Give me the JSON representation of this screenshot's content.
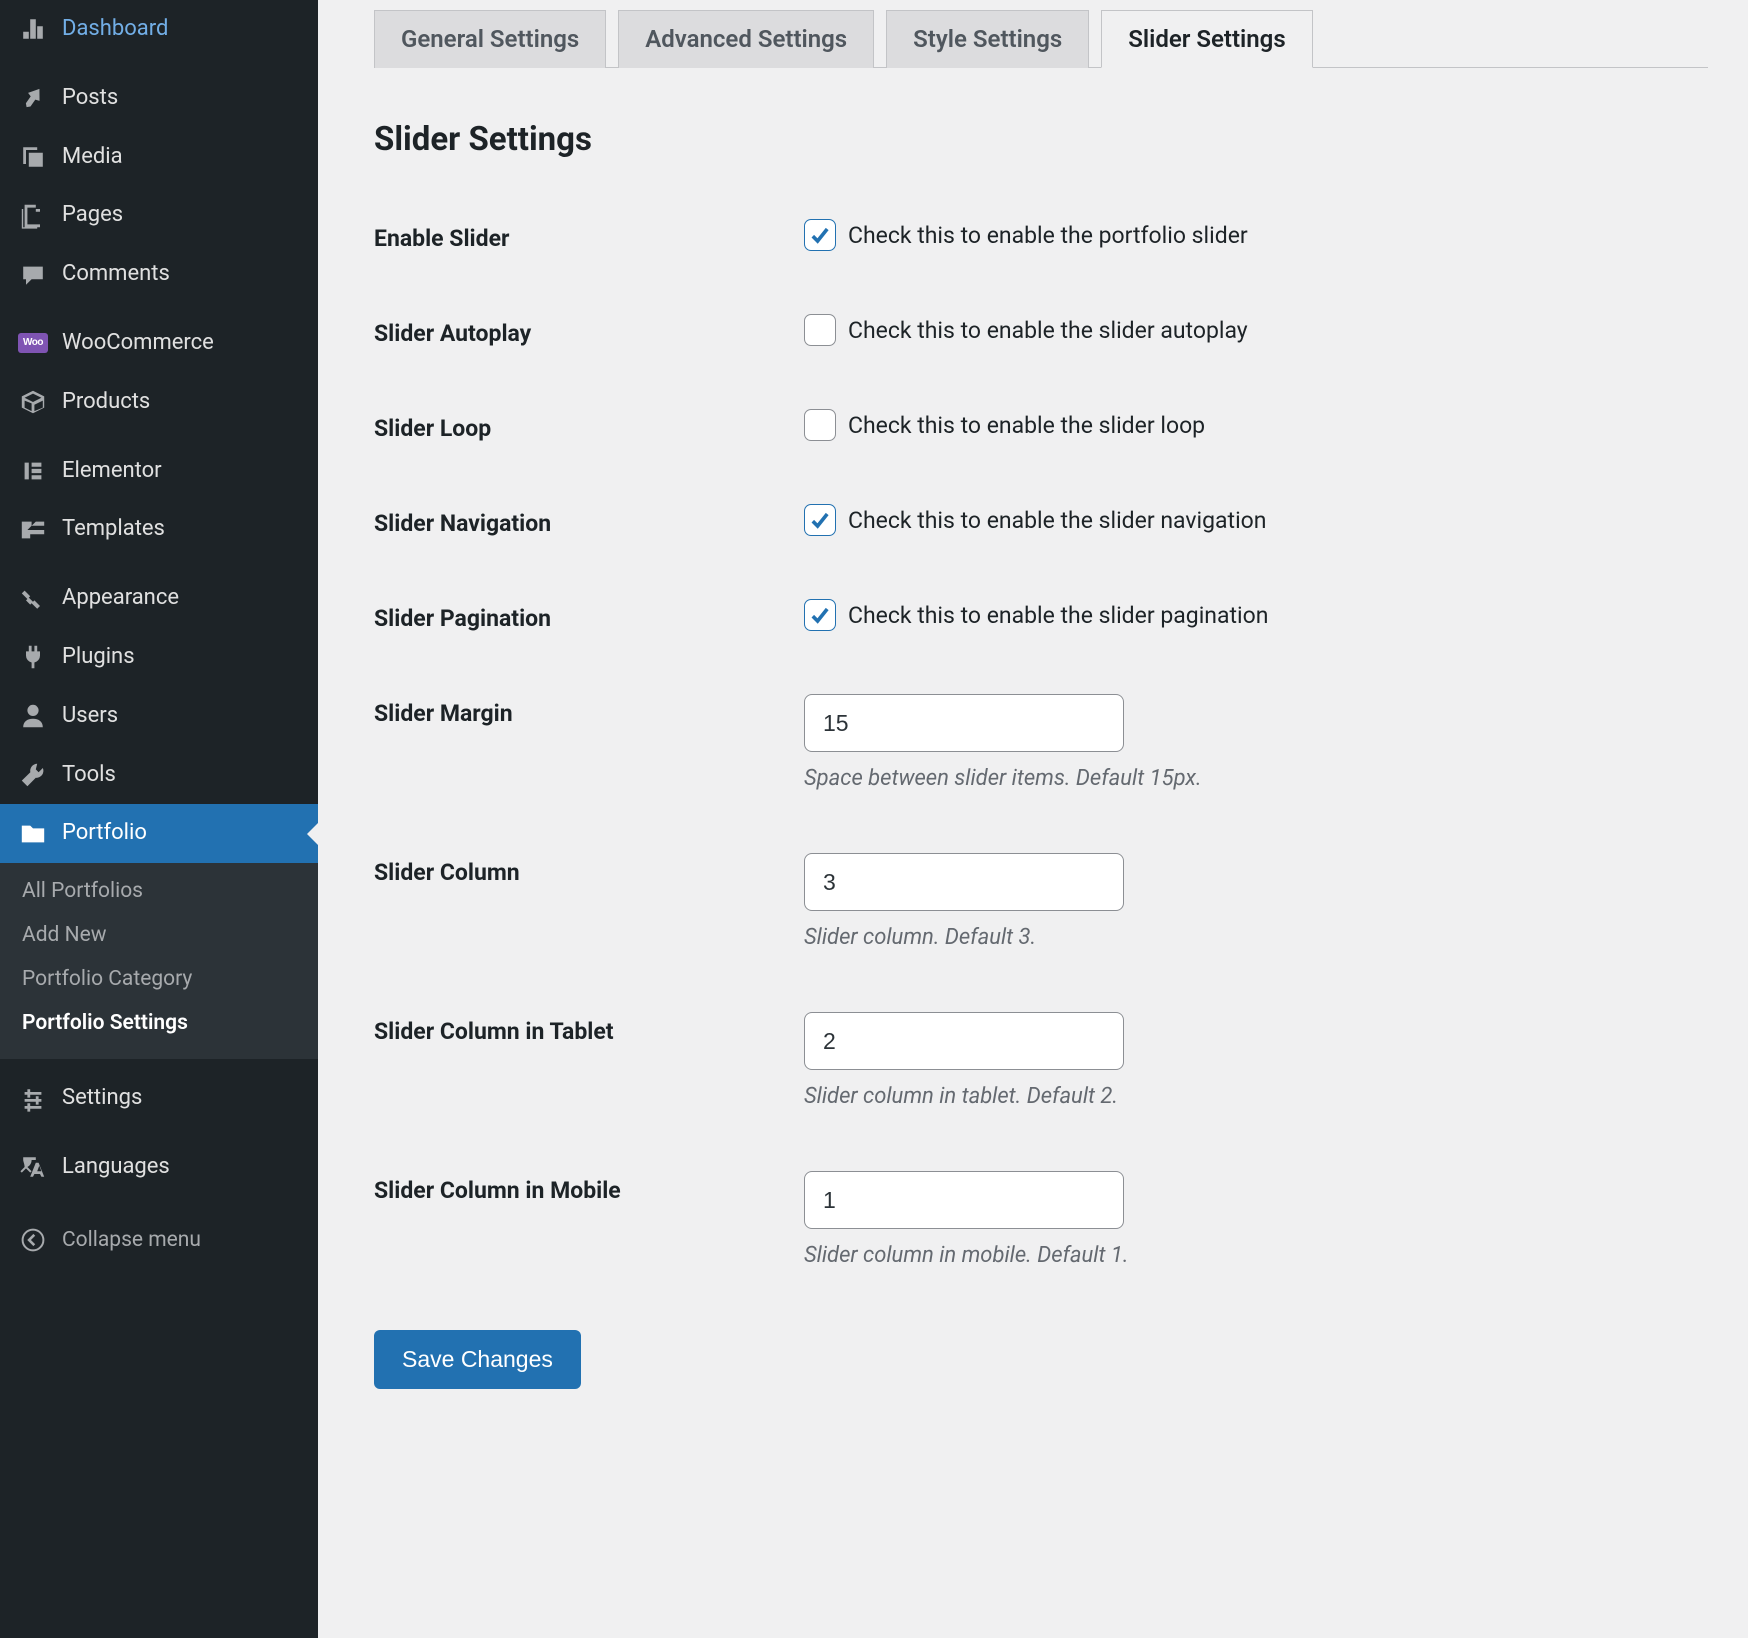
{
  "sidebar": {
    "items": [
      {
        "label": "Dashboard",
        "icon": "dashboard"
      },
      {
        "label": "Posts",
        "icon": "pin"
      },
      {
        "label": "Media",
        "icon": "media"
      },
      {
        "label": "Pages",
        "icon": "pages"
      },
      {
        "label": "Comments",
        "icon": "comments"
      },
      {
        "label": "WooCommerce",
        "icon": "woo"
      },
      {
        "label": "Products",
        "icon": "products"
      },
      {
        "label": "Elementor",
        "icon": "elementor"
      },
      {
        "label": "Templates",
        "icon": "templates"
      },
      {
        "label": "Appearance",
        "icon": "appearance"
      },
      {
        "label": "Plugins",
        "icon": "plugins"
      },
      {
        "label": "Users",
        "icon": "users"
      },
      {
        "label": "Tools",
        "icon": "tools"
      },
      {
        "label": "Portfolio",
        "icon": "portfolio",
        "active": true
      },
      {
        "label": "Settings",
        "icon": "settings"
      },
      {
        "label": "Languages",
        "icon": "languages"
      }
    ],
    "submenu": [
      {
        "label": "All Portfolios"
      },
      {
        "label": "Add New"
      },
      {
        "label": "Portfolio Category"
      },
      {
        "label": "Portfolio Settings",
        "current": true
      }
    ],
    "collapse": "Collapse menu"
  },
  "tabs": [
    {
      "label": "General Settings"
    },
    {
      "label": "Advanced Settings"
    },
    {
      "label": "Style Settings"
    },
    {
      "label": "Slider Settings",
      "active": true
    }
  ],
  "page_title": "Slider Settings",
  "fields": {
    "enable_slider": {
      "label": "Enable Slider",
      "text": "Check this to enable the portfolio slider",
      "checked": true
    },
    "slider_autoplay": {
      "label": "Slider Autoplay",
      "text": "Check this to enable the slider autoplay",
      "checked": false
    },
    "slider_loop": {
      "label": "Slider Loop",
      "text": "Check this to enable the slider loop",
      "checked": false
    },
    "slider_navigation": {
      "label": "Slider Navigation",
      "text": "Check this to enable the slider navigation",
      "checked": true
    },
    "slider_pagination": {
      "label": "Slider Pagination",
      "text": "Check this to enable the slider pagination",
      "checked": true
    },
    "slider_margin": {
      "label": "Slider Margin",
      "value": "15",
      "desc": "Space between slider items. Default 15px."
    },
    "slider_column": {
      "label": "Slider Column",
      "value": "3",
      "desc": "Slider column. Default 3."
    },
    "slider_column_tablet": {
      "label": "Slider Column in Tablet",
      "value": "2",
      "desc": "Slider column in tablet. Default 2."
    },
    "slider_column_mobile": {
      "label": "Slider Column in Mobile",
      "value": "1",
      "desc": "Slider column in mobile. Default 1."
    }
  },
  "save_button": "Save Changes"
}
